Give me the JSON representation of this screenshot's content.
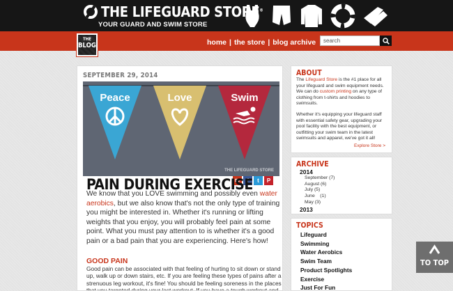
{
  "header": {
    "logo_name": "THE LIFEGUARD STORE",
    "logo_mark": "®",
    "tagline": "YOUR GUARD AND SWIM STORE",
    "product_icons": [
      "swimsuit-icon",
      "swim-shorts-icon",
      "long-sleeve-shirt-icon",
      "life-ring-icon",
      "fins-icon"
    ]
  },
  "nav": {
    "badge_small": "THE",
    "badge_big": "BLOG",
    "items": [
      "home",
      "the store",
      "blog archive"
    ],
    "separator": "|",
    "search_placeholder": "search"
  },
  "post": {
    "date": "SEPTEMBER 29, 2014",
    "hero_pennants": [
      {
        "word": "Peace",
        "color": "#3aa6d4",
        "symbol": "peace-icon"
      },
      {
        "word": "Love",
        "color": "#d8bf70",
        "symbol": "heart-icon"
      },
      {
        "word": "Swim",
        "color": "#b4283d",
        "symbol": "swimmer-icon"
      }
    ],
    "hero_watermark": "THE LIFEGUARD STORE",
    "share_buttons": [
      {
        "name": "email-share-icon",
        "glyph": "✉",
        "color": "#c8351b"
      },
      {
        "name": "facebook-share-icon",
        "glyph": "f",
        "color": "#3b5998"
      },
      {
        "name": "twitter-share-icon",
        "glyph": "t",
        "color": "#2a9ad8"
      },
      {
        "name": "pinterest-share-icon",
        "glyph": "P",
        "color": "#c4232b"
      }
    ],
    "title": "PAIN DURING EXERCISE",
    "intro_before": "We know that you LOVE swimming and possibly even ",
    "intro_link": "water aerobics",
    "intro_after": ", but we also know that's not the only type of training you might be interested in. Whether it's running or lifting weights that you enjoy, you will probably feel pain at some point. What you must pay attention to is whether it's a good pain or a bad pain that you are experiencing. Here's how!",
    "section_title": "GOOD PAIN",
    "section_text": "Good pain can be associated with that feeling of hurting to sit down or stand up, walk up or down stairs, etc. If you are feeling these types of pains after a strenuous leg workout, it's fine! You should be feeling soreness in the places that you targeted during your last workout. If you have a tough workout and you are still suffering from soreness days after, you"
  },
  "about": {
    "heading": "ABOUT",
    "p1_a": "The ",
    "p1_link1": "Lifeguard Store",
    "p1_b": " is the #1 place for all your lifeguard and swim equipment needs. We can do ",
    "p1_link2": "custom printing",
    "p1_c": " on any type of clothing from t-shirts and hoodies to swimsuits.",
    "p2": "Whether it's equipping your lifeguard staff with essential safety gear, upgrading your pool facility with the best equipment, or outfitting your swim team in the latest swimsuits and apparel, we've got it all!",
    "explore": "Explore Store >"
  },
  "archive": {
    "heading": "ARCHIVE",
    "years": [
      {
        "year": "2014",
        "months": [
          "September (7)",
          "August (6)",
          "July (5)",
          "June    (1)",
          "May (3)"
        ]
      },
      {
        "year": "2013",
        "months": []
      }
    ]
  },
  "topics": {
    "heading": "TOPICS",
    "items": [
      "Lifeguard",
      "Swimming",
      "Water Aerobics",
      "Swim Team",
      "Product Spotlights",
      "Exercise",
      "Just For Fun"
    ]
  },
  "to_top": {
    "label": "TO TOP"
  }
}
